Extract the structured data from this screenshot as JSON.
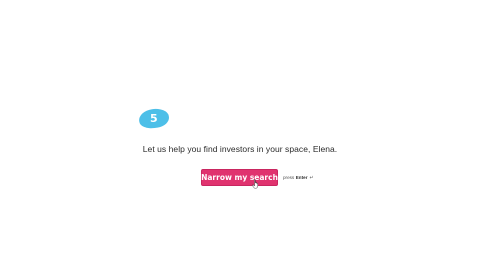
{
  "step": {
    "number": "5",
    "badge_color": "#4dbfe8"
  },
  "prompt": {
    "text": "Let us help you find investors in your space, Elena."
  },
  "cta": {
    "button_label": "Narrow my search",
    "button_color": "#e0336f",
    "hint_prefix": "press",
    "hint_key": "Enter",
    "hint_icon": "enter-return-icon"
  }
}
